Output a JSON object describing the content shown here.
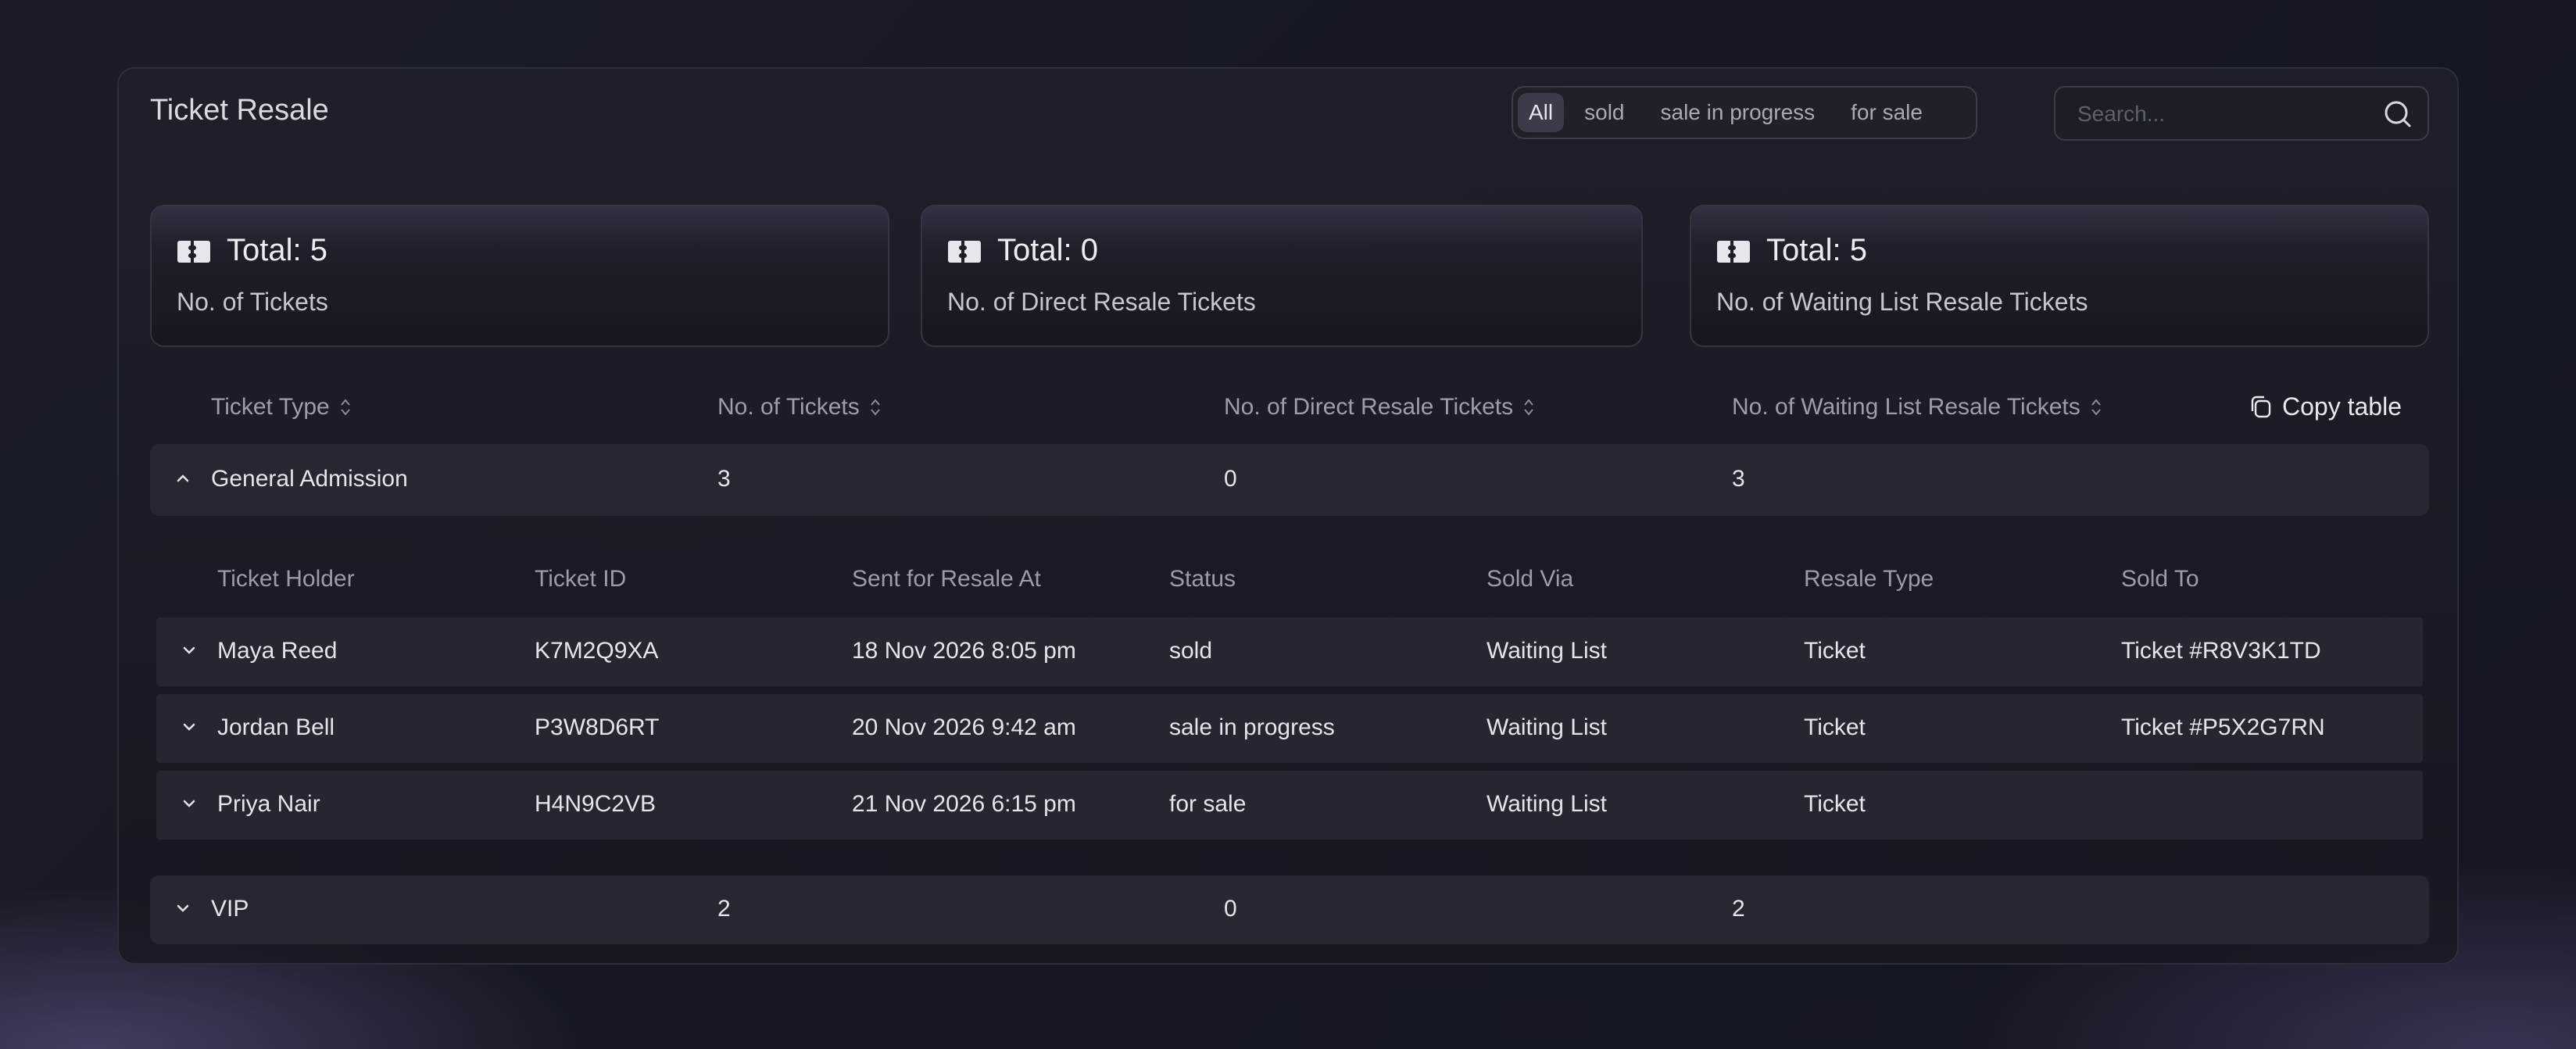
{
  "header": {
    "title": "Ticket Resale",
    "filters": [
      "All",
      "sold",
      "sale in progress",
      "for sale"
    ],
    "search_placeholder": "Search..."
  },
  "cards": [
    {
      "total": "Total: 5",
      "label": "No. of Tickets"
    },
    {
      "total": "Total: 0",
      "label": "No. of Direct Resale Tickets"
    },
    {
      "total": "Total: 5",
      "label": "No. of Waiting List Resale Tickets"
    }
  ],
  "table": {
    "columns": [
      "Ticket Type",
      "No. of Tickets",
      "No. of Direct Resale Tickets",
      "No. of Waiting List Resale Tickets"
    ],
    "copy_label": "Copy table",
    "groups": [
      {
        "type": "General Admission",
        "tickets": "3",
        "direct": "0",
        "waiting": "3"
      },
      {
        "type": "VIP",
        "tickets": "2",
        "direct": "0",
        "waiting": "2"
      }
    ],
    "sub_columns": [
      "Ticket Holder",
      "Ticket ID",
      "Sent for Resale At",
      "Status",
      "Sold Via",
      "Resale Type",
      "Sold To"
    ],
    "sub_rows": [
      {
        "holder": "Maya Reed",
        "id": "K7M2Q9XA",
        "sent": "18 Nov 2026 8:05 pm",
        "status": "sold",
        "via": "Waiting List",
        "type": "Ticket",
        "sold_to": "Ticket #R8V3K1TD"
      },
      {
        "holder": "Jordan Bell",
        "id": "P3W8D6RT",
        "sent": "20 Nov 2026 9:42 am",
        "status": "sale in progress",
        "via": "Waiting List",
        "type": "Ticket",
        "sold_to": "Ticket #P5X2G7RN"
      },
      {
        "holder": "Priya Nair",
        "id": "H4N9C2VB",
        "sent": "21 Nov 2026 6:15 pm",
        "status": "for sale",
        "via": "Waiting List",
        "type": "Ticket",
        "sold_to": ""
      }
    ]
  }
}
